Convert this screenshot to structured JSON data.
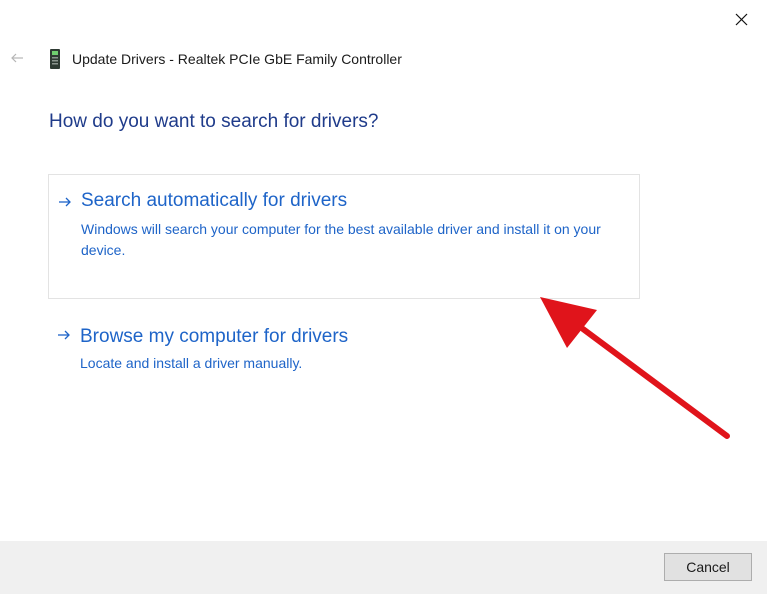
{
  "dialog": {
    "title": "Update Drivers - Realtek PCIe GbE Family Controller",
    "heading": "How do you want to search for drivers?"
  },
  "options": [
    {
      "title": "Search automatically for drivers",
      "description": "Windows will search your computer for the best available driver and install it on your device."
    },
    {
      "title": "Browse my computer for drivers",
      "description": "Locate and install a driver manually."
    }
  ],
  "footer": {
    "cancel_label": "Cancel"
  },
  "icons": {
    "close": "close-icon",
    "back": "back-arrow-icon",
    "device": "network-adapter-icon",
    "option_arrow": "arrow-right-icon",
    "annotation": "red-pointer-arrow"
  },
  "colors": {
    "heading": "#1f3b8a",
    "link": "#1e64c8",
    "annotation": "#e0141b",
    "footer_bg": "#f0f0f0"
  }
}
